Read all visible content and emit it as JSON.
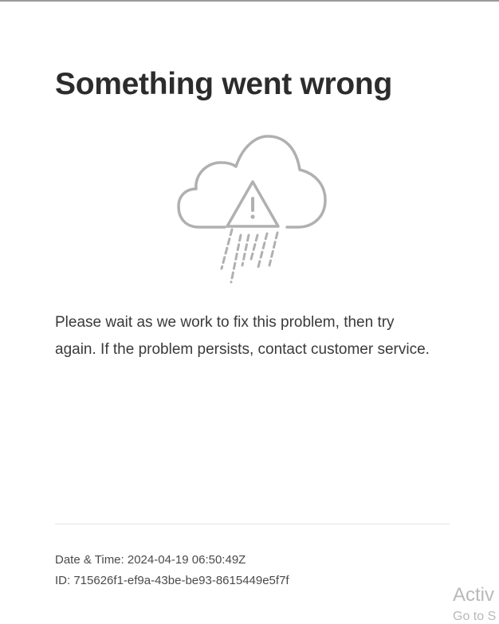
{
  "error": {
    "title": "Something went wrong",
    "illustration_icon": "cloud-warning-rain-icon",
    "message": "Please wait as we work to fix this problem, then try again. If the problem persists, contact customer service."
  },
  "details": {
    "datetime_label": "Date & Time:",
    "datetime_value": "2024-04-19 06:50:49Z",
    "id_label": "ID:",
    "id_value": "715626f1-ef9a-43be-be93-8615449e5f7f"
  },
  "watermark": {
    "line1": "Activ",
    "line2": "Go to S"
  },
  "colors": {
    "title": "#2c2c2c",
    "body": "#3a3a3a",
    "icon": "#b0b0b0",
    "divider": "#e6e6e6"
  }
}
